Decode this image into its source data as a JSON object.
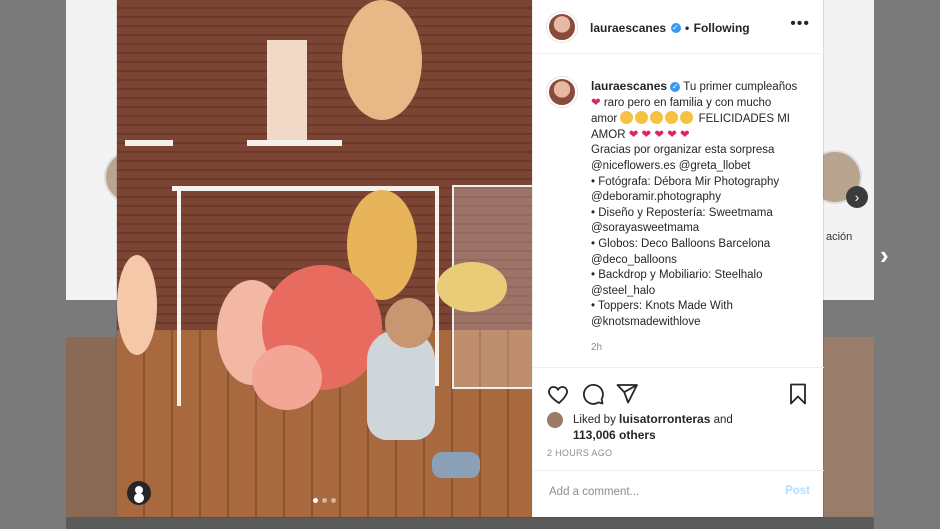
{
  "header": {
    "username": "lauraescanes",
    "separator": "•",
    "follow_label": "Following",
    "more_label": "•••"
  },
  "caption": {
    "username": "lauraescanes",
    "lines": [
      "Tu primer cumpleaños",
      "raro pero en familia y con mucho",
      "amor",
      "FELICIDADES MI",
      "AMOR",
      "Gracias por organizar esta sorpresa",
      "@niceflowers.es @greta_llobet",
      "• Fotógrafa: Débora Mir Photography",
      "@deboramir.photography",
      "• Diseño y Repostería: Sweetmama",
      "@sorayasweetmama",
      "• Globos: Deco Balloons Barcelona",
      "@deco_balloons",
      "• Backdrop y Mobiliario: Steelhalo",
      "@steel_halo",
      "• Toppers: Knots Made With",
      "@knotsmadewithlove"
    ],
    "time": "2h"
  },
  "likes": {
    "prefix": "Liked by",
    "user": "luisatorronteras",
    "conjunction": "and",
    "count": "113,006 others"
  },
  "posted_time": "2 HOURS AGO",
  "comment": {
    "placeholder": "Add a comment...",
    "post_label": "Post"
  },
  "background": {
    "story_label": "ación"
  },
  "carousel": {
    "slide_count": 3,
    "active_index": 0
  },
  "colors": {
    "heart": "#e0245e",
    "verified": "#3897f0",
    "post_disabled": "#b2dffc"
  }
}
